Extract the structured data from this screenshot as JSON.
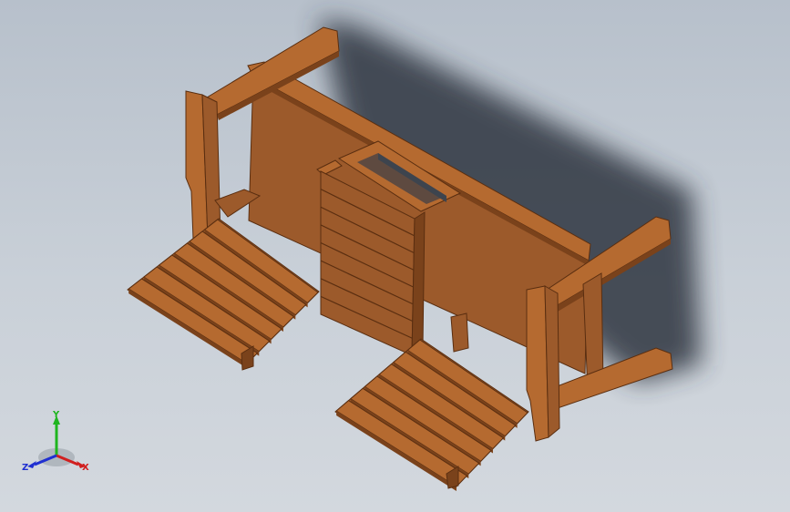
{
  "colors": {
    "wood_light": "#b56a30",
    "wood_mid": "#9c5a2b",
    "wood_dark": "#7a421b",
    "wood_edge": "#5a2e10",
    "shadow": "#2e3540",
    "background_top": "#b7c0cb",
    "background_bottom": "#d3d8de",
    "axis_x": "#d11f1f",
    "axis_y": "#1fb51f",
    "axis_z": "#1f2fd1"
  },
  "triad": {
    "x_label": "X",
    "y_label": "Y",
    "z_label": "Z"
  }
}
